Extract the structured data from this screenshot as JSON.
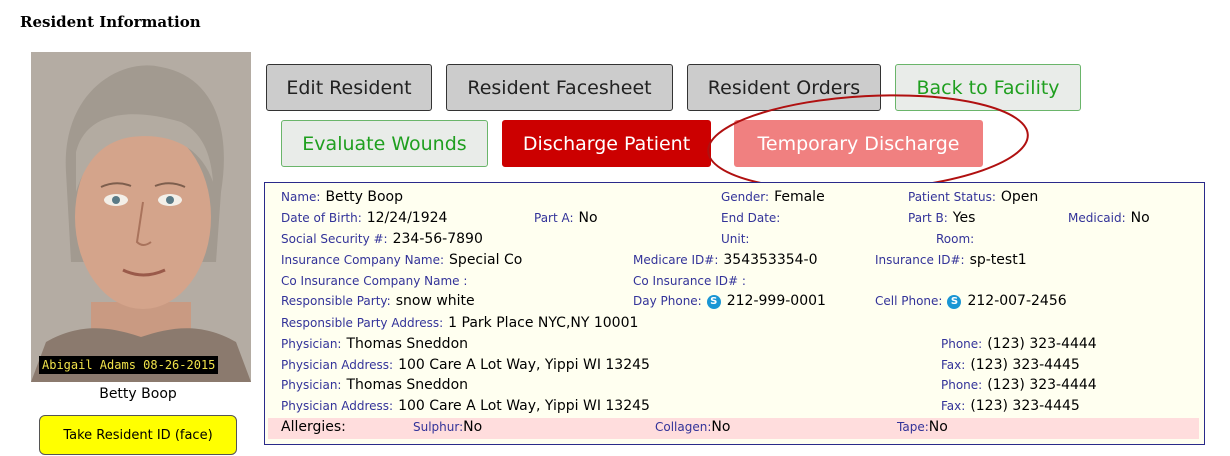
{
  "page": {
    "title": "Resident Information"
  },
  "photo": {
    "stamp": "Abigail Adams 08-26-2015",
    "caption": "Betty Boop"
  },
  "take_id_button": "Take Resident ID (face)",
  "buttons": {
    "edit_resident": "Edit Resident",
    "resident_facesheet": "Resident Facesheet",
    "resident_orders": "Resident Orders",
    "back_to_facility": "Back to Facility",
    "evaluate_wounds": "Evaluate Wounds",
    "discharge_patient": "Discharge Patient",
    "temporary_discharge": "Temporary Discharge"
  },
  "info": {
    "name_label": "Name:",
    "name": "Betty Boop",
    "gender_label": "Gender:",
    "gender": "Female",
    "patient_status_label": "Patient Status:",
    "patient_status": "Open",
    "dob_label": "Date of Birth:",
    "dob": "12/24/1924",
    "part_a_label": "Part A:",
    "part_a": "No",
    "end_date_label": "End Date:",
    "end_date": "",
    "part_b_label": "Part B:",
    "part_b": "Yes",
    "medicaid_label": "Medicaid:",
    "medicaid": "No",
    "ssn_label": "Social Security #:",
    "ssn": "234-56-7890",
    "unit_label": "Unit:",
    "unit": "",
    "room_label": "Room:",
    "room": "",
    "ins_company_label": "Insurance Company Name:",
    "ins_company": "Special Co",
    "medicare_id_label": "Medicare ID#:",
    "medicare_id": "354353354-0",
    "insurance_id_label": "Insurance ID#:",
    "insurance_id": "sp-test1",
    "co_ins_company_label": "Co Insurance Company Name :",
    "co_ins_company": "",
    "co_ins_id_label": "Co Insurance ID# :",
    "co_ins_id": "",
    "responsible_party_label": "Responsible Party:",
    "responsible_party": "snow white",
    "day_phone_label": "Day Phone:",
    "day_phone": "212-999-0001",
    "cell_phone_label": "Cell Phone:",
    "cell_phone": "212-007-2456",
    "rp_address_label": "Responsible Party Address:",
    "rp_address": "1 Park Place NYC,NY 10001",
    "physicians": [
      {
        "name_label": "Physician:",
        "name": "Thomas Sneddon",
        "address_label": "Physician Address:",
        "address": "100 Care A Lot Way, Yippi WI 13245",
        "phone_label": "Phone:",
        "phone": "(123) 323-4444",
        "fax_label": "Fax:",
        "fax": "(123) 323-4445"
      },
      {
        "name_label": "Physician:",
        "name": "Thomas Sneddon",
        "address_label": "Physician Address:",
        "address": "100 Care A Lot Way, Yippi WI 13245",
        "phone_label": "Phone:",
        "phone": "(123) 323-4444",
        "fax_label": "Fax:",
        "fax": "(123) 323-4445"
      }
    ],
    "allergies": {
      "label": "Allergies:",
      "sulphur_label": "Sulphur:",
      "sulphur": "No",
      "collagen_label": "Collagen:",
      "collagen": "No",
      "tape_label": "Tape:",
      "tape": "No"
    }
  },
  "icons": {
    "phone_icon": "skype-icon",
    "phone_icon_glyph": "S"
  },
  "colors": {
    "accent_red": "#cc0000",
    "accent_pink": "#f08080",
    "accent_green": "#1f9f1f",
    "annotation_circle": "#b01010",
    "allergies_bg": "#ffdddd",
    "info_bg": "#fffff0"
  }
}
